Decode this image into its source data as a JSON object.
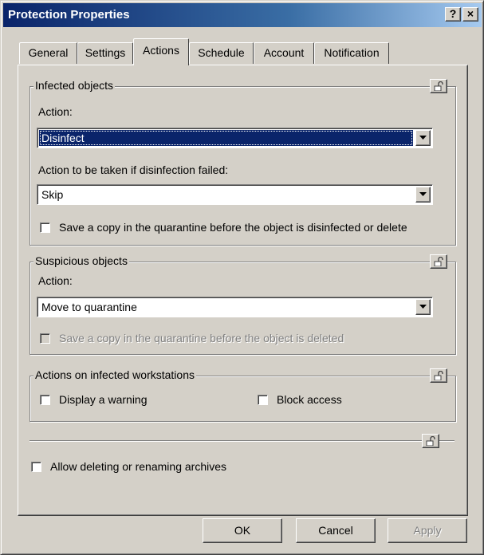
{
  "window": {
    "title": "Protection Properties",
    "help_button": "?",
    "close_button": "×"
  },
  "tabs": [
    {
      "label": "General"
    },
    {
      "label": "Settings"
    },
    {
      "label": "Actions",
      "active": true
    },
    {
      "label": "Schedule"
    },
    {
      "label": "Account"
    },
    {
      "label": "Notification"
    }
  ],
  "infected": {
    "title": "Infected objects",
    "action_label": "Action:",
    "action_value": "Disinfect",
    "failed_label": "Action to be taken if disinfection failed:",
    "failed_value": "Skip",
    "save_copy_label": "Save a copy in the quarantine before the object is disinfected or delete",
    "save_copy_checked": false
  },
  "suspicious": {
    "title": "Suspicious objects",
    "action_label": "Action:",
    "action_value": "Move to quarantine",
    "save_copy_label": "Save a copy in the quarantine before the object is  deleted",
    "save_copy_checked": false,
    "save_copy_enabled": false
  },
  "workstations": {
    "title": "Actions on infected workstations",
    "display_warning_label": "Display a warning",
    "display_warning_checked": false,
    "block_access_label": "Block access",
    "block_access_checked": false
  },
  "archives": {
    "allow_label": "Allow deleting or renaming archives",
    "allow_checked": false
  },
  "buttons": {
    "ok": "OK",
    "cancel": "Cancel",
    "apply": "Apply"
  },
  "colors": {
    "titlebar_start": "#0a246a",
    "titlebar_end": "#a6caf0",
    "face": "#d4d0c8",
    "selection": "#0a246a"
  }
}
